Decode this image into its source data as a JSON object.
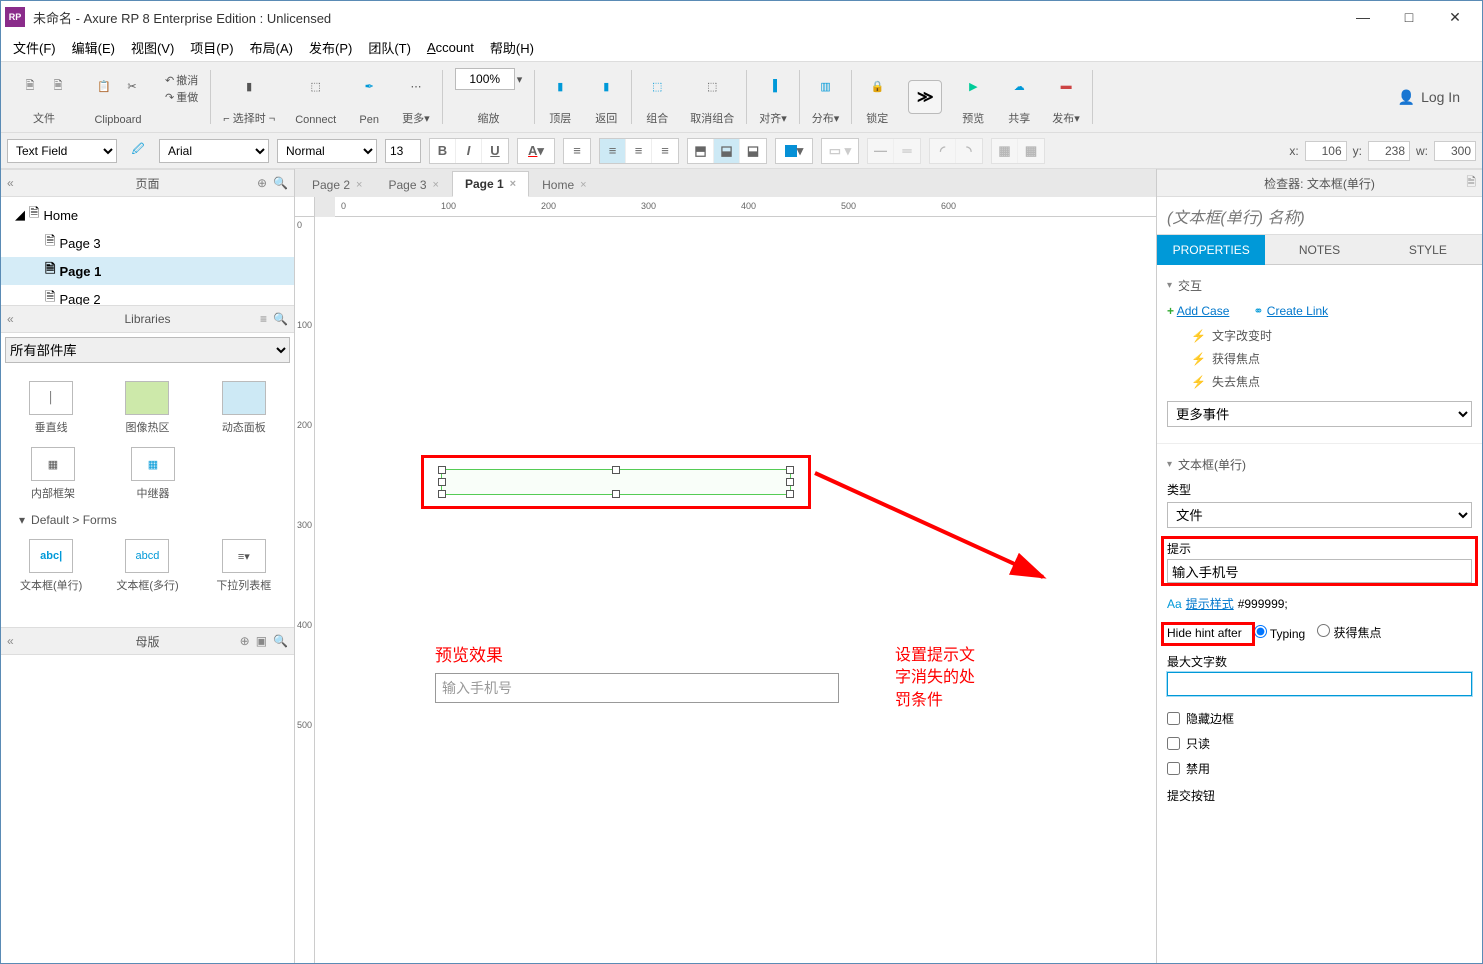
{
  "titlebar": {
    "title": "未命名 - Axure RP 8 Enterprise Edition : Unlicensed",
    "logo": "RP"
  },
  "menubar": [
    "文件(F)",
    "编辑(E)",
    "视图(V)",
    "项目(P)",
    "布局(A)",
    "发布(P)",
    "团队(T)",
    "Account",
    "帮助(H)"
  ],
  "toolbar": {
    "file": "文件",
    "clipboard": "Clipboard",
    "undo": "撤消",
    "redo": "重做",
    "select": "选择时",
    "connect": "Connect",
    "pen": "Pen",
    "more": "更多",
    "zoom": "缩放",
    "zoom_val": "100%",
    "front": "顶层",
    "back": "返回",
    "group": "组合",
    "ungroup": "取消组合",
    "align": "对齐",
    "distribute": "分布",
    "lock": "锁定",
    "preview": "预览",
    "share": "共享",
    "publish": "发布",
    "morebtn": "≫",
    "login": "Log In"
  },
  "subtoolbar": {
    "shape": "Text Field",
    "font": "Arial",
    "weight": "Normal",
    "size": "13",
    "coord_x_lbl": "x:",
    "coord_x": "106",
    "coord_y_lbl": "y:",
    "coord_y": "238",
    "coord_w_lbl": "w:",
    "coord_w": "300"
  },
  "pages": {
    "header": "页面",
    "tree": [
      {
        "label": "Home",
        "type": "home"
      },
      {
        "label": "Page 3",
        "type": "sub"
      },
      {
        "label": "Page 1",
        "type": "sub",
        "sel": true
      },
      {
        "label": "Page 2",
        "type": "sub"
      }
    ]
  },
  "libraries": {
    "header": "Libraries",
    "sel": "所有部件库",
    "row1": [
      "垂直线",
      "图像热区",
      "动态面板"
    ],
    "row2": [
      "内部框架",
      "中继器"
    ],
    "section": "Default > Forms",
    "row3": [
      "文本框(单行)",
      "文本框(多行)",
      "下拉列表框"
    ]
  },
  "masters": {
    "header": "母版"
  },
  "tabs": [
    {
      "label": "Page 2"
    },
    {
      "label": "Page 3"
    },
    {
      "label": "Page 1",
      "active": true
    },
    {
      "label": "Home"
    }
  ],
  "ruler_h": [
    "0",
    "100",
    "200",
    "300",
    "400",
    "500",
    "600"
  ],
  "ruler_v": [
    "0",
    "100",
    "200",
    "300",
    "400",
    "500"
  ],
  "canvas": {
    "preview_label": "预览效果",
    "anno2": "设置提示文字消失的处罚条件",
    "preview_input": "输入手机号"
  },
  "inspector": {
    "header": "检查器: 文本框(单行)",
    "name_placeholder": "(文本框(单行) 名称)",
    "tabs": [
      "PROPERTIES",
      "NOTES",
      "STYLE"
    ],
    "interact_h": "交互",
    "add_case": "Add Case",
    "create_link": "Create Link",
    "events": [
      "文字改变时",
      "获得焦点",
      "失去焦点"
    ],
    "more_events": "更多事件",
    "widget_h": "文本框(单行)",
    "type_lbl": "类型",
    "type_val": "文件",
    "hint_lbl": "提示",
    "hint_val": "输入手机号",
    "hintstyle_lbl": "提示样式",
    "hintstyle_val": "#999999;",
    "hidehint": "Hide hint after",
    "radio1": "Typing",
    "radio2": "获得焦点",
    "maxchars": "最大文字数",
    "hideborder": "隐藏边框",
    "readonly": "只读",
    "disabled": "禁用",
    "submitbtn": "提交按钮"
  }
}
